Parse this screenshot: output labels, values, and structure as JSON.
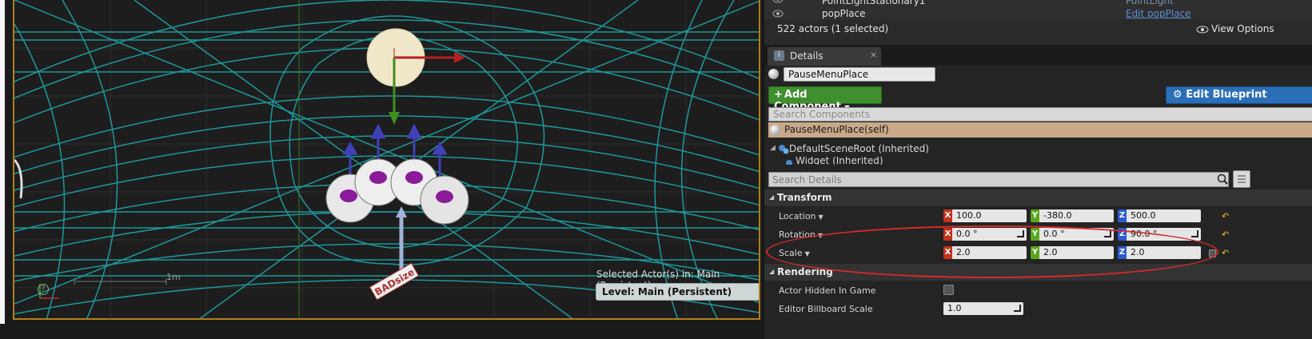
{
  "viewport": {
    "selected_actors_label": "Selected Actor(s) in:  Main (Persistent)",
    "level_label": "Level:  Main (Persistent)",
    "scale_ruler_label": "1m",
    "billboard_text": "BADsize",
    "help_glyph": "?"
  },
  "outliner": {
    "rows": [
      {
        "name": "PointLightStationary1",
        "type": "PointLight"
      },
      {
        "name": "popPlace",
        "edit_link": "Edit popPlace"
      }
    ],
    "actor_count": "522 actors (1 selected)",
    "view_options": "View Options"
  },
  "details_tab": {
    "label": "Details",
    "icon": "info-icon",
    "close_glyph": "×"
  },
  "details": {
    "actor_name": "PauseMenuPlace",
    "add_component_label": "Add Component",
    "edit_blueprint_label": "Edit Blueprint",
    "search_components_placeholder": "Search Components",
    "components": {
      "self": "PauseMenuPlace(self)",
      "root": "DefaultSceneRoot (Inherited)",
      "child": "Widget (Inherited)"
    },
    "search_details_placeholder": "Search Details",
    "transform": {
      "header": "Transform",
      "location": {
        "label": "Location",
        "x": "100.0",
        "y": "-380.0",
        "z": "500.0"
      },
      "rotation": {
        "label": "Rotation",
        "x": "0.0 °",
        "y": "0.0 °",
        "z": "90.0 °"
      },
      "scale": {
        "label": "Scale",
        "x": "2.0",
        "y": "2.0",
        "z": "2.0"
      }
    },
    "rendering": {
      "header": "Rendering",
      "actor_hidden_label": "Actor Hidden In Game",
      "actor_hidden_value": false,
      "billboard_scale_label": "Editor Billboard Scale",
      "billboard_scale_value": "1.0"
    }
  },
  "colors": {
    "wire_mesh": "#1fa5a8",
    "selection_border": "#b07f20",
    "annotation_red": "#d62a2a",
    "add_component_green": "#3f8f2f",
    "edit_blueprint_blue": "#2a6fb8"
  }
}
